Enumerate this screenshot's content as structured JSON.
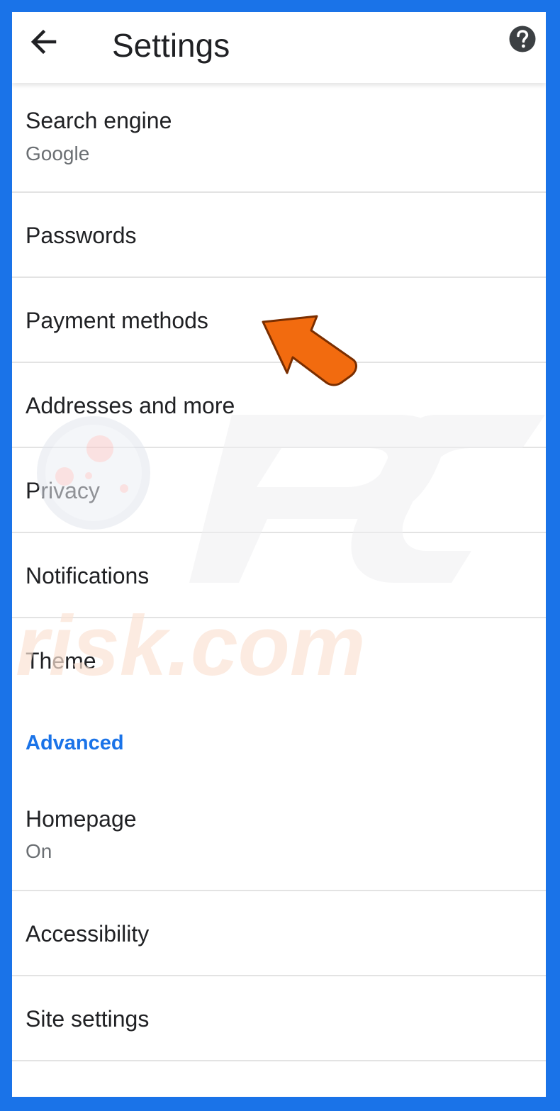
{
  "appbar": {
    "title": "Settings",
    "back_icon": "arrow-left-icon",
    "help_icon": "help-circle-icon"
  },
  "settings": {
    "search_engine": {
      "label": "Search engine",
      "value": "Google"
    },
    "passwords": {
      "label": "Passwords"
    },
    "payment_methods": {
      "label": "Payment methods"
    },
    "addresses": {
      "label": "Addresses and more"
    },
    "privacy": {
      "label": "Privacy"
    },
    "notifications": {
      "label": "Notifications"
    },
    "theme": {
      "label": "Theme"
    },
    "advanced_header": "Advanced",
    "homepage": {
      "label": "Homepage",
      "value": "On"
    },
    "accessibility": {
      "label": "Accessibility"
    },
    "site_settings": {
      "label": "Site settings"
    }
  },
  "annotation": {
    "pointer": "orange-arrow-icon",
    "color": "#f26b0f"
  },
  "watermark": {
    "brand": "PC",
    "domain": "risk.com"
  },
  "colors": {
    "frame": "#1a73e8",
    "accent": "#1a73e8",
    "text": "#202124",
    "secondary": "#6b6f73"
  }
}
